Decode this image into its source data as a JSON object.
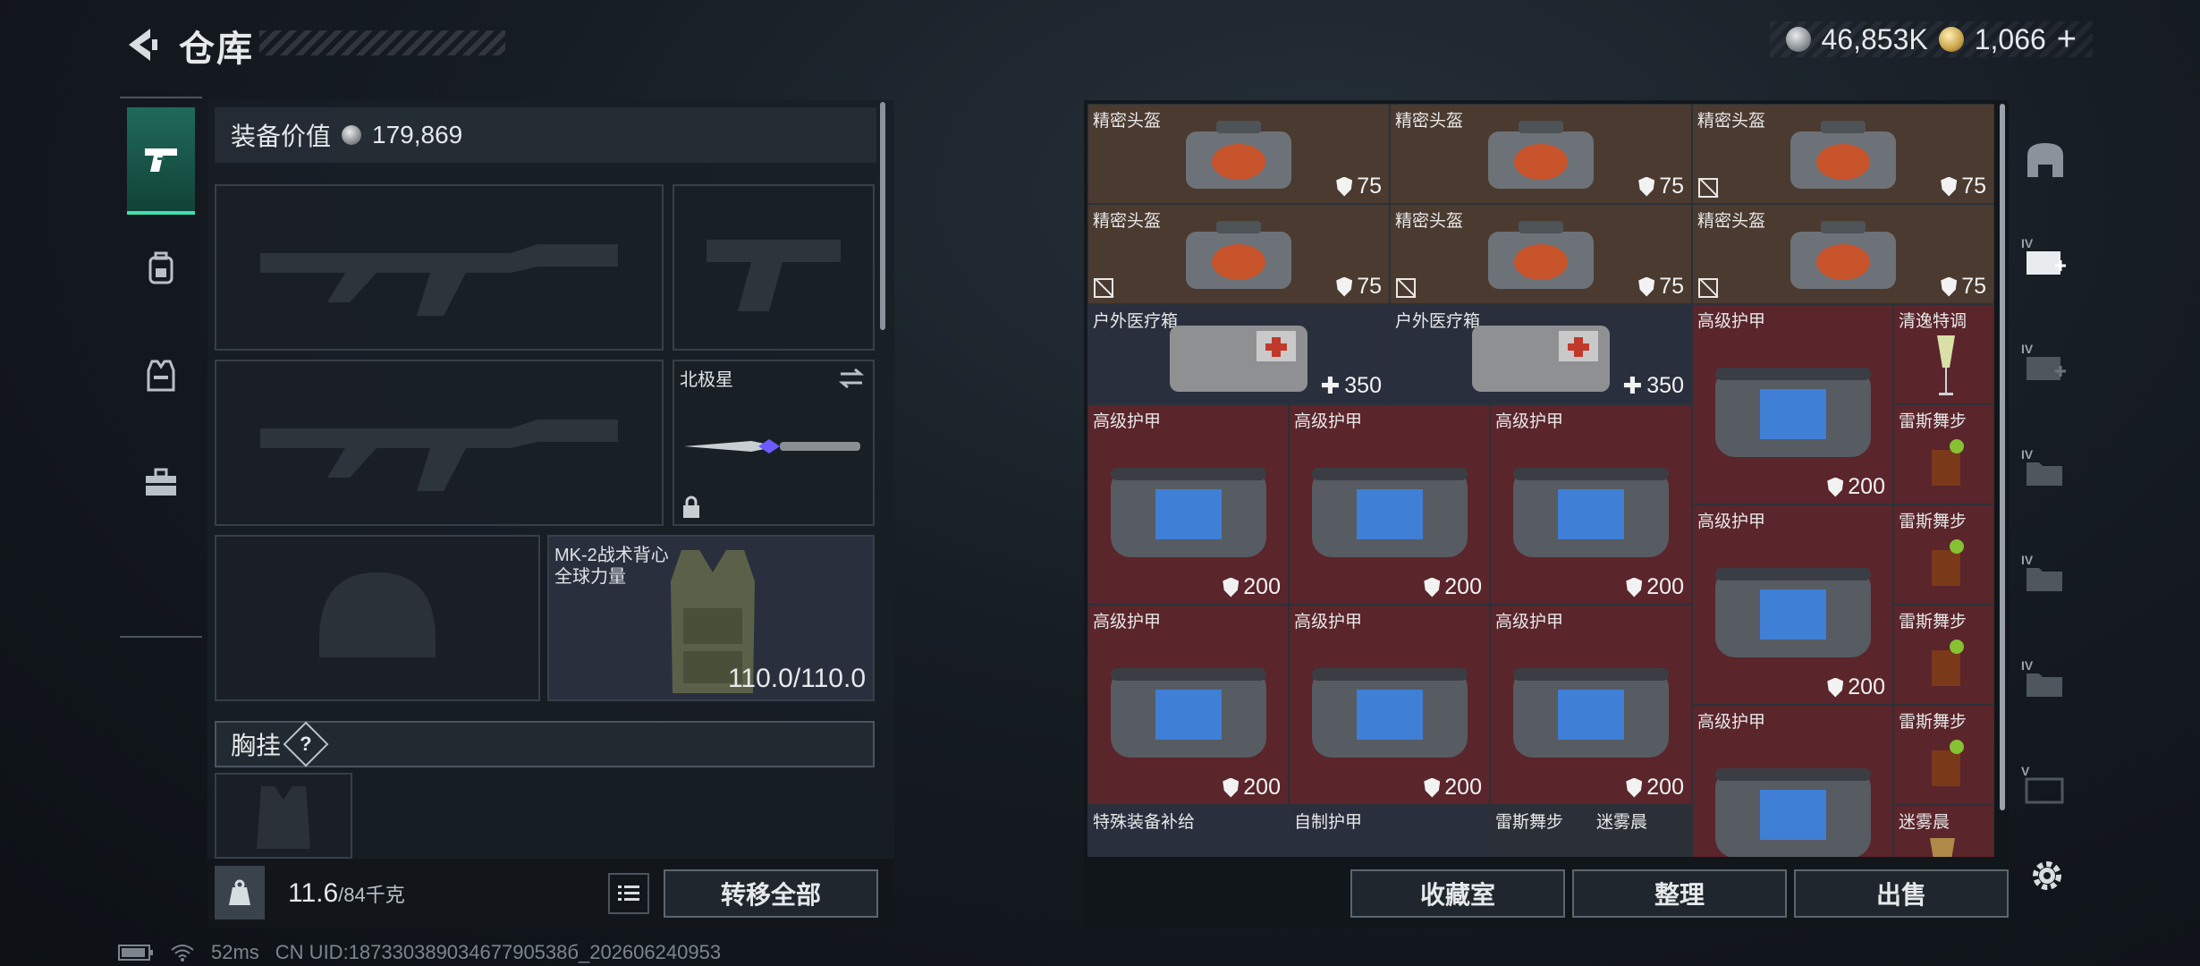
{
  "header": {
    "title": "仓库",
    "currency_silver": "46,853K",
    "currency_gold": "1,066",
    "plus_label": "+"
  },
  "equipment": {
    "value_label": "装备价值",
    "value": "179,869",
    "melee_name": "北极星",
    "armor_name_line1": "MK-2战术背心",
    "armor_name_line2": "全球力量",
    "armor_durability": "110.0/110.0",
    "chest_label": "胸挂",
    "chest_help": "?"
  },
  "weight": {
    "current": "11.6",
    "max_unit": "/84千克"
  },
  "buttons": {
    "transfer_all": "转移全部",
    "collection": "收藏室",
    "organize": "整理",
    "sell": "出售"
  },
  "status": {
    "ping": "52ms",
    "uid": "CN UID:18733038903467790538б_202606240953"
  },
  "grid": {
    "helmet": "精密头盔",
    "helmet_val": "75",
    "medkit": "户外医疗箱",
    "medkit_val": "350",
    "armor": "高级护甲",
    "armor_val": "200",
    "drink1": "清逸特调",
    "drink2": "雷斯舞步",
    "drink3": "迷雾晨",
    "supply": "特殊装备补给",
    "diy_armor": "自制护甲"
  },
  "colors": {
    "helmet_bg": "#4a3a2f",
    "medkit_bg": "#2a2f3e",
    "armor_bg": "#5a252b",
    "active_tab": "#1f6a5a"
  },
  "icons": [
    "back-arrow-icon",
    "pistol-icon",
    "backpack-icon",
    "vest-icon",
    "toolbox-icon",
    "weight-icon",
    "list-icon",
    "gear-icon",
    "shield-icon",
    "medical-cross-icon",
    "no-slot-icon"
  ]
}
